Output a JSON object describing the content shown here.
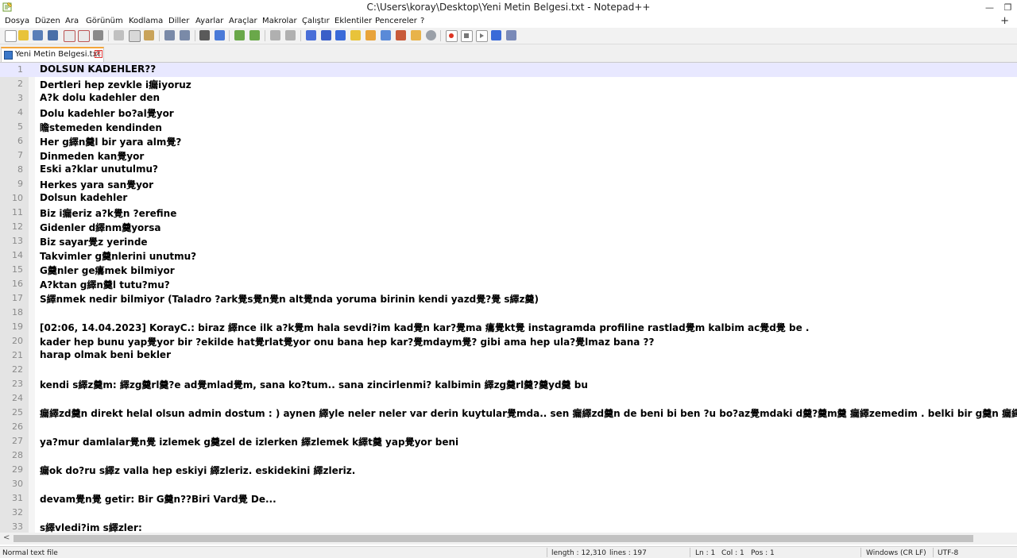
{
  "window": {
    "title": "C:\\Users\\koray\\Desktop\\Yeni Metin Belgesi.txt - Notepad++",
    "minimize": "—",
    "restore": "❐"
  },
  "menu": {
    "items": [
      "Dosya",
      "Düzen",
      "Ara",
      "Görünüm",
      "Kodlama",
      "Diller",
      "Ayarlar",
      "Araçlar",
      "Makrolar",
      "Çalıştır",
      "Eklentiler",
      "Pencereler",
      "?"
    ],
    "plus": "+"
  },
  "toolbar": {
    "icons": [
      "new-file-icon",
      "open-file-icon",
      "save-icon",
      "save-all-icon",
      "close-icon",
      "close-all-icon",
      "print-icon",
      "cut-icon",
      "copy-icon",
      "paste-icon",
      "undo-icon",
      "redo-icon",
      "find-icon",
      "replace-icon",
      "zoom-in-icon",
      "zoom-out-icon",
      "sync-vertical-icon",
      "sync-horizontal-icon",
      "word-wrap-icon",
      "show-all-chars-icon",
      "indent-guide-icon",
      "lang-udl-icon",
      "doc-map-icon",
      "doc-list-icon",
      "function-list-icon",
      "folder-workspace-icon",
      "monitoring-icon",
      "record-macro-icon",
      "stop-macro-icon",
      "play-macro-icon",
      "run-macro-multiple-icon",
      "save-macro-icon"
    ]
  },
  "tab": {
    "label": "Yeni Metin Belgesi.txt",
    "close": "✕"
  },
  "editor": {
    "lines": [
      "DOLSUN KADEHLER??",
      "Dertleri hep zevkle i瘺iyoruz",
      "A?k dolu kadehler den",
      "Dolu kadehler bo?al覺yor",
      "瞻stemeden kendinden",
      "Her g繹n羹l bir yara alm覺?",
      "Dinmeden kan覺yor",
      "Eski a?klar unutulmu?",
      "Herkes yara san覺yor",
      "Dolsun kadehler",
      "Biz i瘺eriz a?k覺n ?erefine",
      "Gidenler d繹nm羹yorsa",
      "Biz sayar覺z yerinde",
      "Takvimler g羹nlerini unutmu?",
      "G羹nler ge癟mek bilmiyor",
      "A?ktan g繹n羹l tutu?mu?",
      "S繹nmek nedir bilmiyor (Taladro ?ark覺s覺n覺n alt覺nda yoruma birinin kendi yazd覺?覺 s繹z羹)",
      "",
      "[02:06, 14.04.2023] KorayC.: biraz 繹nce ilk a?k覺m hala sevdi?im kad覺n kar?覺ma 癟覺kt覺 instagramda profiline rastlad覺m kalbim ac覺d覺 be .",
      "kader hep bunu yap覺yor bir ?ekilde hat覺rlat覺yor onu bana hep kar?覺mdaym覺? gibi ama hep ula?覺lmaz bana ??",
      "harap olmak beni bekler",
      "",
      "kendi s繹z羹m: 繹zg羹rl羹?e ad覺mlad覺m, sana ko?tum.. sana zincirlenmi? kalbimin 繹zg羹rl羹?羹yd羹 bu",
      "",
      "瘺繹zd羹n direkt helal olsun admin dostum : ) aynen 繹yle neler neler var derin kuytular覺mda.. sen 瘺繹zd羹n de beni bi ben ?u bo?az覺mdaki d羹?羹m羹 瘺繹zemedim . belki bir g羹n 瘺繹z",
      "",
      "ya?mur damlalar覺n覺 izlemek g羹zel de izlerken 繹zlemek k繹t羹 yap覺yor beni",
      "",
      "瘺ok do?ru s繹z valla hep eskiyi 繹zleriz. eskidekini 繹zleriz.",
      "",
      "devam覺n覺 getir: Bir G羹n??Biri Vard覺 De...",
      "",
      "s繹vledi?im s繹zler:"
    ],
    "line_numbers": [
      "1",
      "2",
      "3",
      "4",
      "5",
      "6",
      "7",
      "8",
      "9",
      "10",
      "11",
      "12",
      "13",
      "14",
      "15",
      "16",
      "17",
      "18",
      "19",
      "20",
      "21",
      "22",
      "23",
      "24",
      "25",
      "26",
      "27",
      "28",
      "29",
      "30",
      "31",
      "32",
      "33"
    ]
  },
  "hscroll": {
    "left_arrow": "<"
  },
  "status": {
    "type": "Normal text file",
    "length": "length : 12,310",
    "lines": "lines : 197",
    "ln": "Ln : 1",
    "col": "Col : 1",
    "pos": "Pos : 1",
    "eol": "Windows (CR LF)",
    "encoding": "UTF-8"
  },
  "colors": {
    "current_line": "#e8e8ff",
    "tab_accent": "#f4a53a",
    "gutter": "#e4e4e4"
  }
}
